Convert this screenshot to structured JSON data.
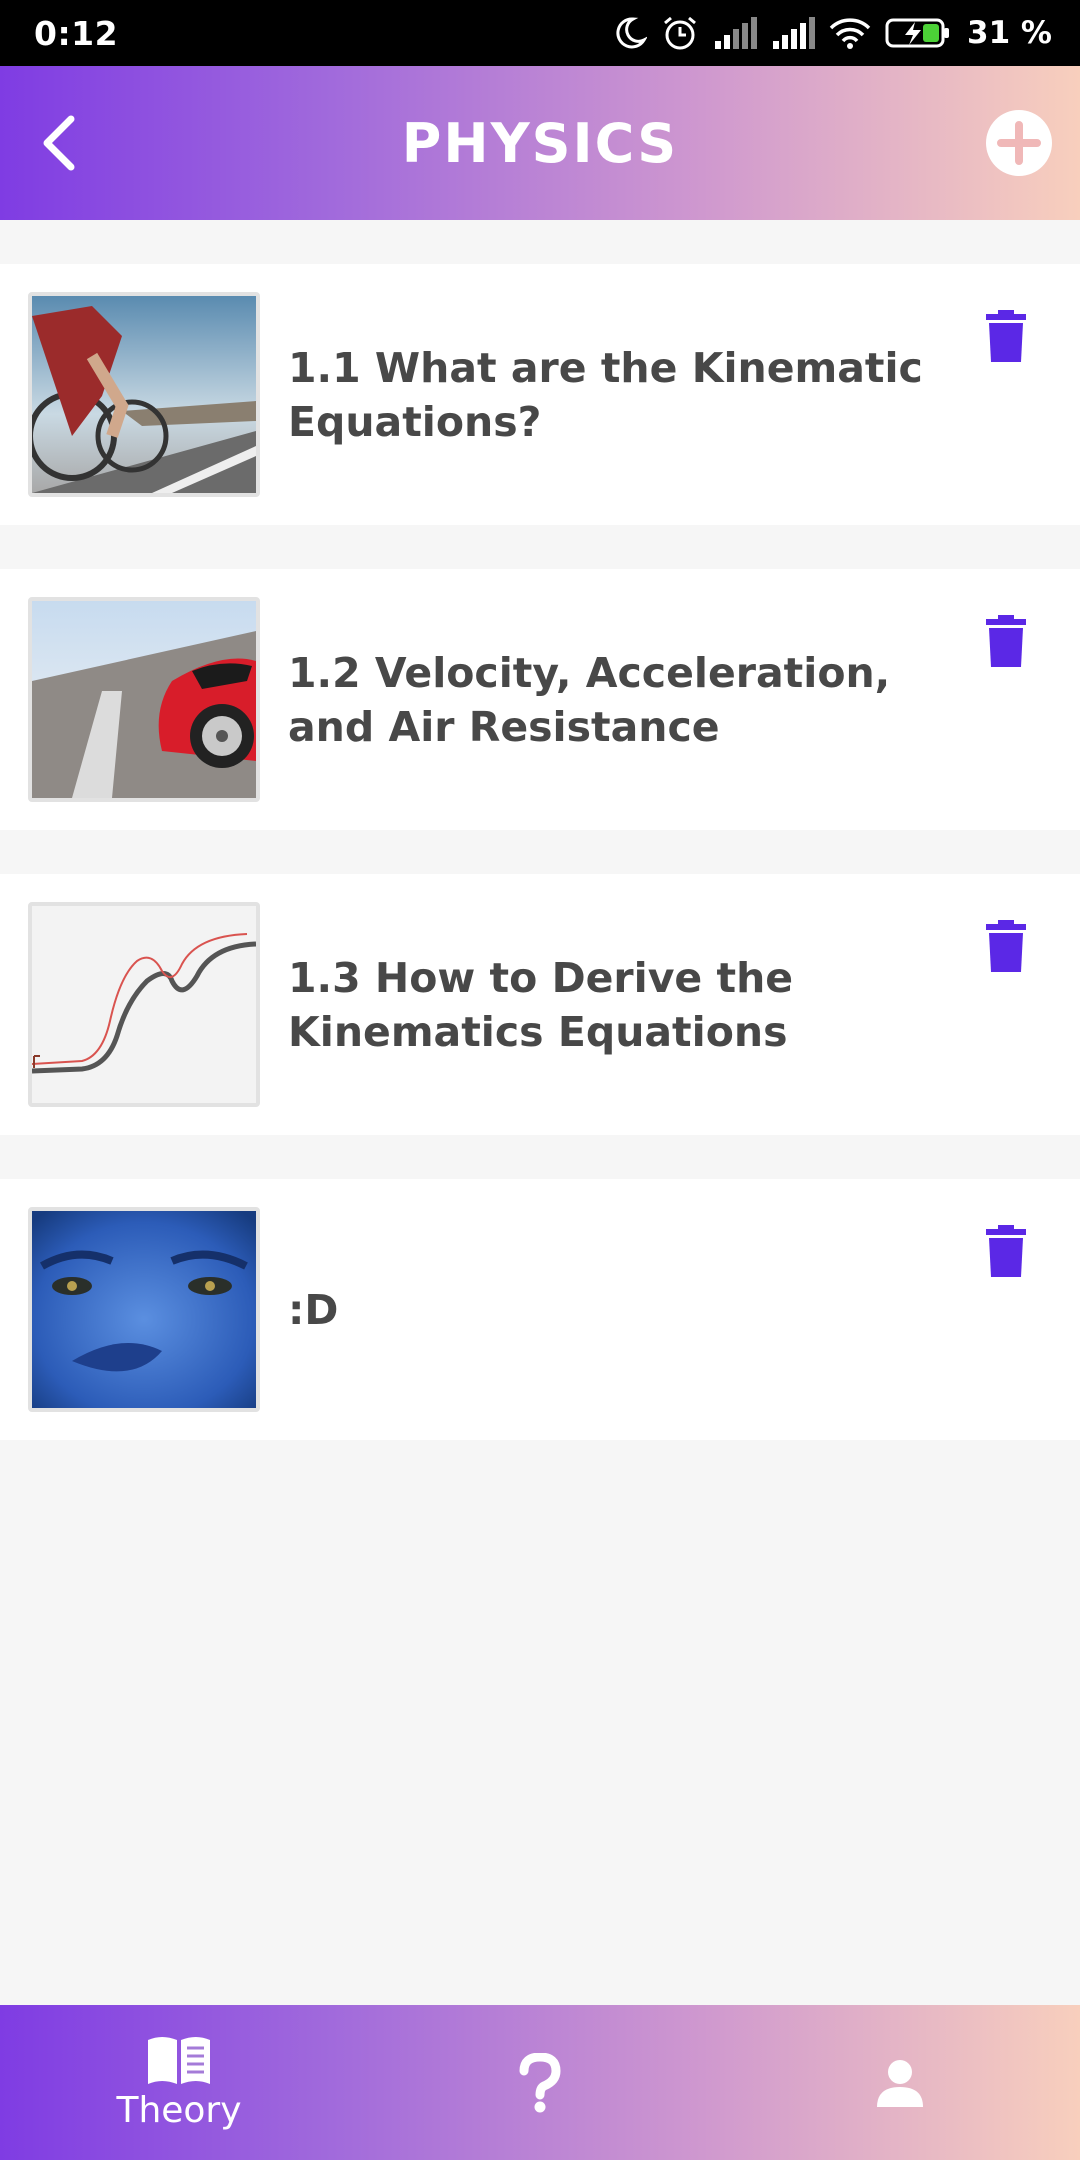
{
  "status_bar": {
    "time": "0:12",
    "battery_percent": "31 %",
    "icons": [
      "moon-icon",
      "alarm-icon",
      "signal-icon",
      "signal-icon",
      "wifi-icon",
      "battery-charging-icon"
    ]
  },
  "header": {
    "title": "PHYSICS",
    "back_icon": "chevron-left-icon",
    "add_icon": "plus-circle-icon"
  },
  "topics": [
    {
      "title": "1.1 What are the Kinematic Equations?",
      "thumbnail": "cyclist-photo"
    },
    {
      "title": "1.2 Velocity, Acceleration, and Air Resistance",
      "thumbnail": "red-sports-car-photo"
    },
    {
      "title": "1.3 How to Derive the Kinematics Equations",
      "thumbnail": "curve-graph"
    },
    {
      "title": ":D",
      "thumbnail": "blue-face-photo"
    }
  ],
  "delete_icon": "trash-icon",
  "bottom_nav": {
    "theory_label": "Theory",
    "items": [
      "book-icon",
      "question-mark-icon",
      "user-icon"
    ]
  },
  "colors": {
    "gradient_start": "#7f3ce3",
    "gradient_end": "#f8cfbd",
    "delete_icon": "#5b28e6",
    "title_text": "#484848",
    "background": "#f6f6f6"
  }
}
